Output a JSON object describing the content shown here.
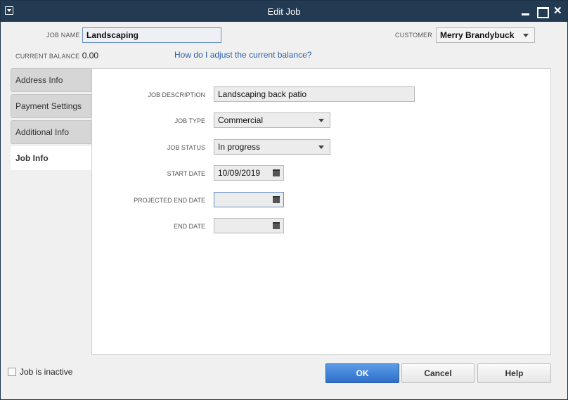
{
  "window": {
    "title": "Edit Job"
  },
  "header": {
    "job_name_label": "JOB NAME",
    "job_name_value": "Landscaping",
    "customer_label": "CUSTOMER",
    "customer_value": "Merry Brandybuck",
    "current_balance_label": "CURRENT BALANCE",
    "current_balance_value": "0.00",
    "adjust_balance_link": "How do I adjust the current balance?"
  },
  "tabs": [
    {
      "label": "Address Info"
    },
    {
      "label": "Payment Settings"
    },
    {
      "label": "Additional Info"
    },
    {
      "label": "Job Info",
      "active": true
    }
  ],
  "job_info": {
    "description_label": "JOB DESCRIPTION",
    "description_value": "Landscaping back patio",
    "type_label": "JOB TYPE",
    "type_value": "Commercial",
    "status_label": "JOB STATUS",
    "status_value": "In progress",
    "start_date_label": "START DATE",
    "start_date_value": "10/09/2019",
    "projected_end_label": "PROJECTED END DATE",
    "projected_end_value": "",
    "end_date_label": "END DATE",
    "end_date_value": ""
  },
  "footer": {
    "inactive_label": "Job is inactive",
    "inactive_checked": false,
    "ok_label": "OK",
    "cancel_label": "Cancel",
    "help_label": "Help"
  },
  "colors": {
    "titlebar": "#223a52",
    "primary_button": "#2f6fc8",
    "link": "#2d5fa8"
  }
}
